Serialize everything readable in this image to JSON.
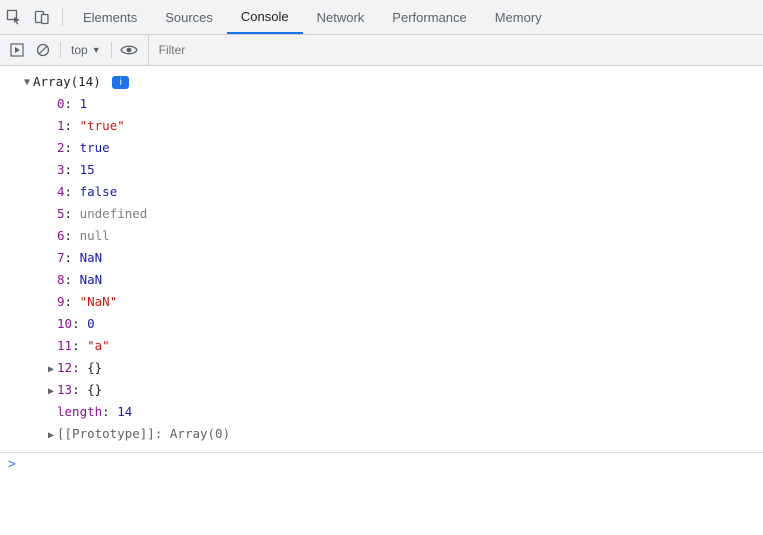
{
  "toolbar": {
    "tabs": [
      "Elements",
      "Sources",
      "Console",
      "Network",
      "Performance",
      "Memory"
    ],
    "active_tab_index": 2
  },
  "subbar": {
    "context_label": "top",
    "filter_placeholder": "Filter"
  },
  "console": {
    "array_header_prefix": "Array(",
    "array_header_count": "14",
    "array_header_suffix": ")",
    "badge": "i",
    "entries": [
      {
        "index": "0",
        "value": "1",
        "cls": "num",
        "expandable": false
      },
      {
        "index": "1",
        "value": "\"true\"",
        "cls": "str",
        "expandable": false
      },
      {
        "index": "2",
        "value": "true",
        "cls": "kw",
        "expandable": false
      },
      {
        "index": "3",
        "value": "15",
        "cls": "num",
        "expandable": false
      },
      {
        "index": "4",
        "value": "false",
        "cls": "kw",
        "expandable": false
      },
      {
        "index": "5",
        "value": "undefined",
        "cls": "undef",
        "expandable": false
      },
      {
        "index": "6",
        "value": "null",
        "cls": "nullv",
        "expandable": false
      },
      {
        "index": "7",
        "value": "NaN",
        "cls": "kw",
        "expandable": false
      },
      {
        "index": "8",
        "value": "NaN",
        "cls": "kw",
        "expandable": false
      },
      {
        "index": "9",
        "value": "\"NaN\"",
        "cls": "str",
        "expandable": false
      },
      {
        "index": "10",
        "value": "0",
        "cls": "num",
        "expandable": false
      },
      {
        "index": "11",
        "value": "\"a\"",
        "cls": "str",
        "expandable": false
      },
      {
        "index": "12",
        "value": "{}",
        "cls": "obj",
        "expandable": true
      },
      {
        "index": "13",
        "value": "{}",
        "cls": "obj",
        "expandable": true
      }
    ],
    "length_label": "length",
    "length_value": "14",
    "prototype_label": "[[Prototype]]",
    "prototype_value": "Array(0)"
  },
  "prompt": ">"
}
